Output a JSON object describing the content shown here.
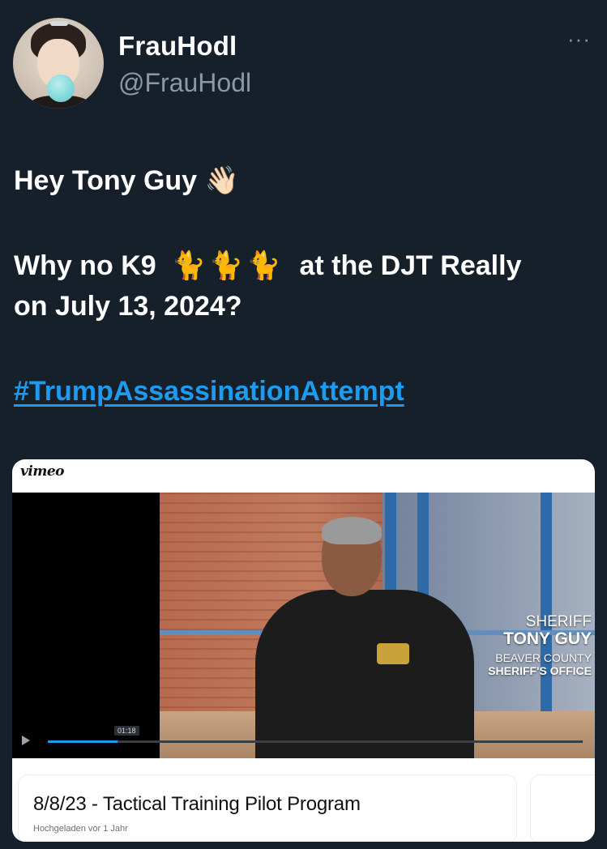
{
  "author": {
    "display_name": "FrauHodl",
    "handle": "@FrauHodl"
  },
  "more_menu": {
    "icon": "more-horizontal-icon",
    "glyph": "···"
  },
  "tweet": {
    "line1_text": "Hey Tony Guy",
    "line1_emoji": "👋🏻",
    "line2_prefix": "Why no K9",
    "line2_emoji": "🐈🐈🐈",
    "line2_suffix": "at the DJT Really",
    "line3": "on July 13, 2024?",
    "hashtag": "#TrumpAssassinationAttempt"
  },
  "embed": {
    "provider": "vimeo",
    "video": {
      "overlay_line1": "SHERIFF",
      "overlay_line2": "TONY GUY",
      "overlay_line3": "BEAVER COUNTY",
      "overlay_line4": "SHERIFF'S OFFICE",
      "time": "01:18",
      "progress": 0.13
    },
    "title": "8/8/23 - Tactical Training Pilot Program",
    "subtitle": "Hochgeladen vor 1 Jahr"
  },
  "colors": {
    "background": "#15202b",
    "hashtag": "#1d9bf0",
    "handle": "#8b98a5"
  }
}
